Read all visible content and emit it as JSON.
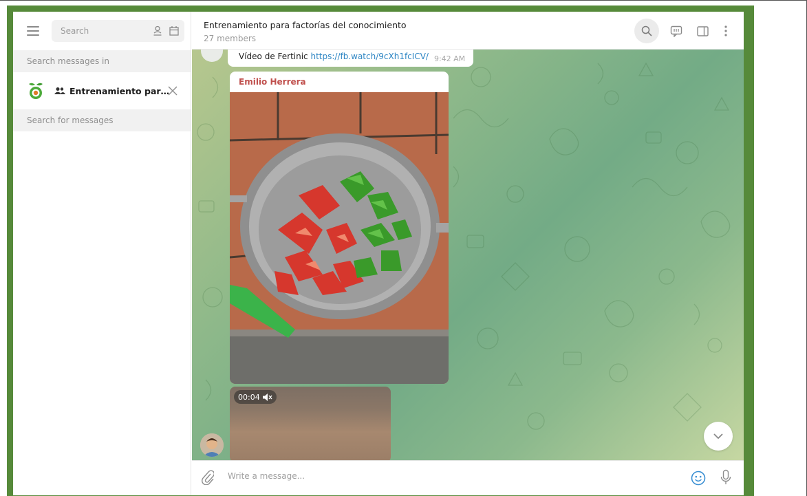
{
  "sidebar": {
    "search_placeholder": "Search",
    "search_messages_in_label": "Search messages in",
    "chat": {
      "name": "Entrenamiento par…"
    },
    "search_for_messages_label": "Search for messages"
  },
  "header": {
    "title": "Entrenamiento para factorías del conocimiento",
    "subtitle": "27 members"
  },
  "messages": {
    "top": {
      "text": "Vídeo de Fertinic ",
      "link": "https://fb.watch/9cXh1fcICV/",
      "time": "9:42 AM"
    },
    "photo": {
      "sender": "Emilio Herrera"
    },
    "video": {
      "duration": "00:04"
    }
  },
  "composer": {
    "placeholder": "Write a message..."
  },
  "icons": {
    "menu": "hamburger-menu-icon",
    "contacts": "person-icon",
    "calendar": "calendar-icon",
    "group": "group-icon",
    "close": "close-icon",
    "search": "search-icon",
    "comments": "comments-icon",
    "sidebar_toggle": "sidebar-toggle-icon",
    "more": "more-vertical-icon",
    "attach": "paperclip-icon",
    "emoji": "emoji-icon",
    "mic": "microphone-icon",
    "scroll_down": "chevron-down-icon",
    "mute": "muted-speaker-icon"
  },
  "colors": {
    "frame": "#568a3a",
    "sender_name": "#c0504d",
    "link": "#2e86c4",
    "accent": "#3a8fd3"
  }
}
